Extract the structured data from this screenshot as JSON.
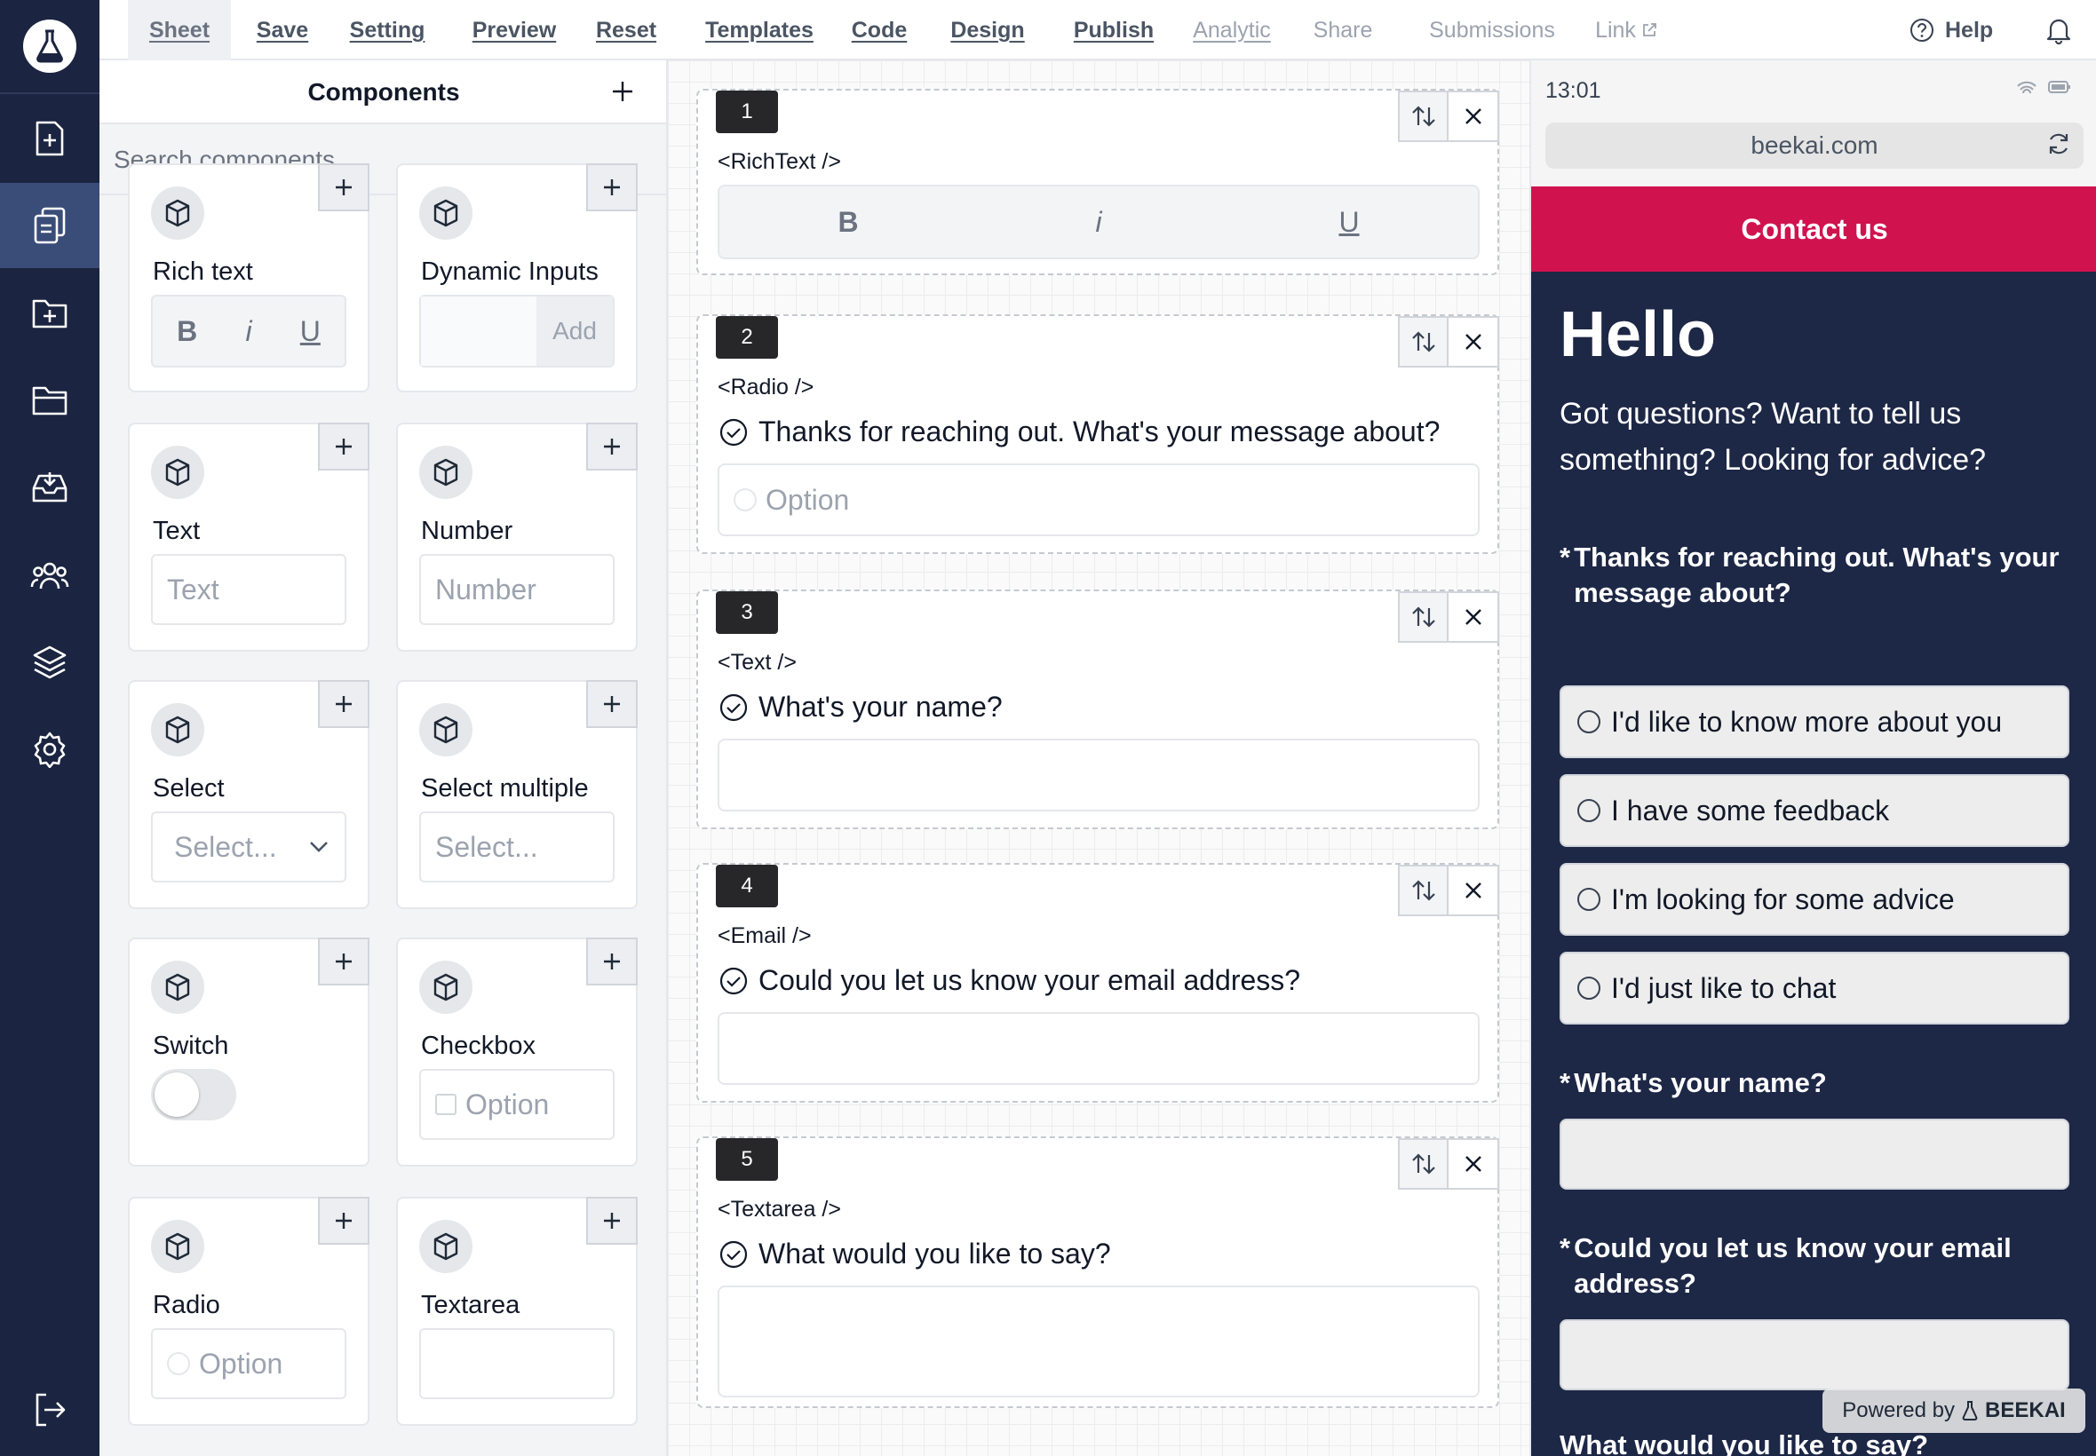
{
  "nav": {
    "items": [
      {
        "label": "Sheet",
        "state": "active"
      },
      {
        "label": "Save",
        "state": "normal"
      },
      {
        "label": "Setting",
        "state": "normal"
      },
      {
        "label": "Preview",
        "state": "normal"
      },
      {
        "label": "Reset",
        "state": "normal"
      },
      {
        "label": "Templates",
        "state": "normal"
      },
      {
        "label": "Code",
        "state": "normal"
      },
      {
        "label": "Design",
        "state": "normal"
      },
      {
        "label": "Publish",
        "state": "normal"
      },
      {
        "label": "Analytic",
        "state": "disabled"
      },
      {
        "label": "Share",
        "state": "disabled"
      },
      {
        "label": "Submissions",
        "state": "disabled"
      },
      {
        "label": "Link",
        "state": "disabled"
      }
    ],
    "help_label": "Help"
  },
  "sidebar": {
    "icons": [
      "new-form-icon",
      "forms-icon",
      "add-folder-icon",
      "folder-icon",
      "inbox-icon",
      "users-icon",
      "layers-icon",
      "settings-icon"
    ],
    "active_index": 1,
    "logout_icon": "logout-icon"
  },
  "components": {
    "title": "Components",
    "search_placeholder": "Search components...",
    "cards": [
      {
        "name": "Rich text",
        "preview": "rich",
        "bold": "B",
        "italic": "i",
        "underline": "U"
      },
      {
        "name": "Dynamic Inputs",
        "preview": "dynamic",
        "button": "Add"
      },
      {
        "name": "Text",
        "preview": "input",
        "placeholder": "Text"
      },
      {
        "name": "Number",
        "preview": "input",
        "placeholder": "Number"
      },
      {
        "name": "Select",
        "preview": "select",
        "placeholder": "Select..."
      },
      {
        "name": "Select multiple",
        "preview": "input",
        "placeholder": "Select..."
      },
      {
        "name": "Switch",
        "preview": "switch"
      },
      {
        "name": "Checkbox",
        "preview": "checkbox",
        "option": "Option"
      },
      {
        "name": "Radio",
        "preview": "radio",
        "option": "Option"
      },
      {
        "name": "Textarea",
        "preview": "textarea"
      }
    ]
  },
  "canvas": {
    "blocks": [
      {
        "num": "1",
        "tag": "<RichText />",
        "question": "",
        "field": "rich",
        "bold": "B",
        "italic": "i",
        "underline": "U"
      },
      {
        "num": "2",
        "tag": "<Radio />",
        "question": "Thanks for reaching out. What's your message about?",
        "field": "radio",
        "option": "Option"
      },
      {
        "num": "3",
        "tag": "<Text />",
        "question": "What's your name?",
        "field": "input"
      },
      {
        "num": "4",
        "tag": "<Email />",
        "question": "Could you let us know your email address?",
        "field": "input"
      },
      {
        "num": "5",
        "tag": "<Textarea />",
        "question": "What would you like to say?",
        "field": "textarea"
      }
    ]
  },
  "preview": {
    "time": "13:01",
    "url": "beekai.com",
    "cta": "Contact us",
    "heading": "Hello",
    "intro": "Got questions? Want to tell us something? Looking for advice?",
    "q1": "Thanks for reaching out. What's your message about?",
    "options": [
      "I'd like to know more about you",
      "I have some feedback",
      "I'm looking for some advice",
      "I'd just like to chat"
    ],
    "q2": "What's your name?",
    "q3": "Could you let us know your email address?",
    "q4": "What would you like to say?",
    "required_mark": "*",
    "powered_prefix": "Powered by",
    "powered_brand": "BEEKAI",
    "colors": {
      "cta": "#d0134f",
      "background": "#1d2746"
    }
  }
}
